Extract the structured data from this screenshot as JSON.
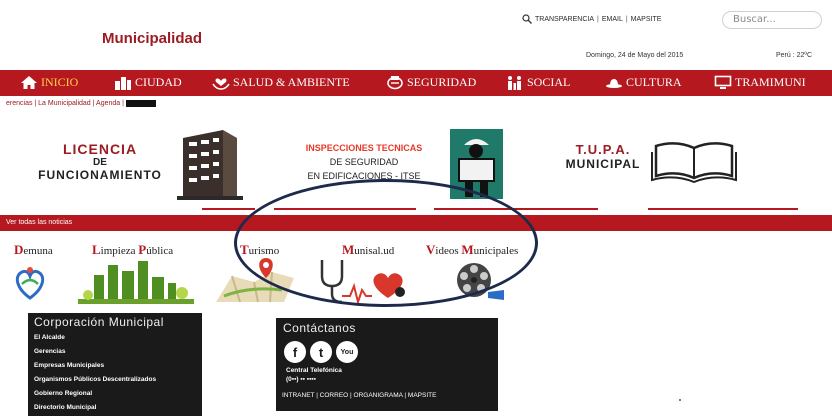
{
  "header": {
    "brand": "Municipalidad",
    "top_links": [
      "TRANSPARENCIA",
      "EMAIL",
      "MAPSITE"
    ],
    "search_placeholder": "Buscar...",
    "date": "Domingo, 24 de Mayo del 2015",
    "weather": "Perú : 22ºC"
  },
  "nav": {
    "items": [
      {
        "label": "INICIO",
        "icon": "home-icon",
        "active": true
      },
      {
        "label": "CIUDAD",
        "icon": "city-icon"
      },
      {
        "label": "SALUD & AMBIENTE",
        "icon": "health-hands-icon"
      },
      {
        "label": "SEGURIDAD",
        "icon": "security-badge-icon"
      },
      {
        "label": "SOCIAL",
        "icon": "people-icon"
      },
      {
        "label": "CULTURA",
        "icon": "hat-icon"
      },
      {
        "label": "TRAMIMUNI",
        "icon": "monitor-icon"
      }
    ]
  },
  "subbar": {
    "text": "erencias | La Municipalidad | Agenda |"
  },
  "banners": {
    "licencia": {
      "l1": "LICENCIA",
      "l2": "DE",
      "l3": "FUNCIONAMIENTO"
    },
    "inspecciones": {
      "l1": "INSPECCIONES TECNICAS",
      "l2": "DE SEGURIDAD",
      "l3": "EN EDIFICACIONES - ITSE"
    },
    "tupa": {
      "l1": "T.U.P.A.",
      "l2": "MUNICIPAL"
    }
  },
  "news_bar": {
    "text": "Ver todas las noticias"
  },
  "services": [
    {
      "first": "D",
      "rest": "emuna"
    },
    {
      "first": "L",
      "rest": "impieza ",
      "first2": "P",
      "rest2": "ública"
    },
    {
      "first": "T",
      "rest": "urismo"
    },
    {
      "first": "M",
      "rest": "unisal.ud"
    },
    {
      "first": "V",
      "rest": "ideos ",
      "first2": "M",
      "rest2": "unicipales"
    }
  ],
  "corporacion": {
    "title": "Corporación Municipal",
    "items": [
      "El Alcalde",
      "Gerencias",
      "Empresas Municipales",
      "Organismos Públicos Descentralizados",
      "Gobierno Regional",
      "Directorio Municipal"
    ]
  },
  "contacto": {
    "title": "Contáctanos",
    "social": [
      "f",
      "t",
      "You"
    ],
    "phone_label": "Central Telefónica",
    "phone": "(0▪▪) ▪▪ ▪▪▪▪",
    "links": "INTRANET | CORREO | ORGANIGRAMA | MAPSITE"
  },
  "colors": {
    "primary_red": "#b5181e",
    "dark_box": "#1a1a1a",
    "oval": "#1d2a4c",
    "active_nav": "#ffd34a"
  }
}
